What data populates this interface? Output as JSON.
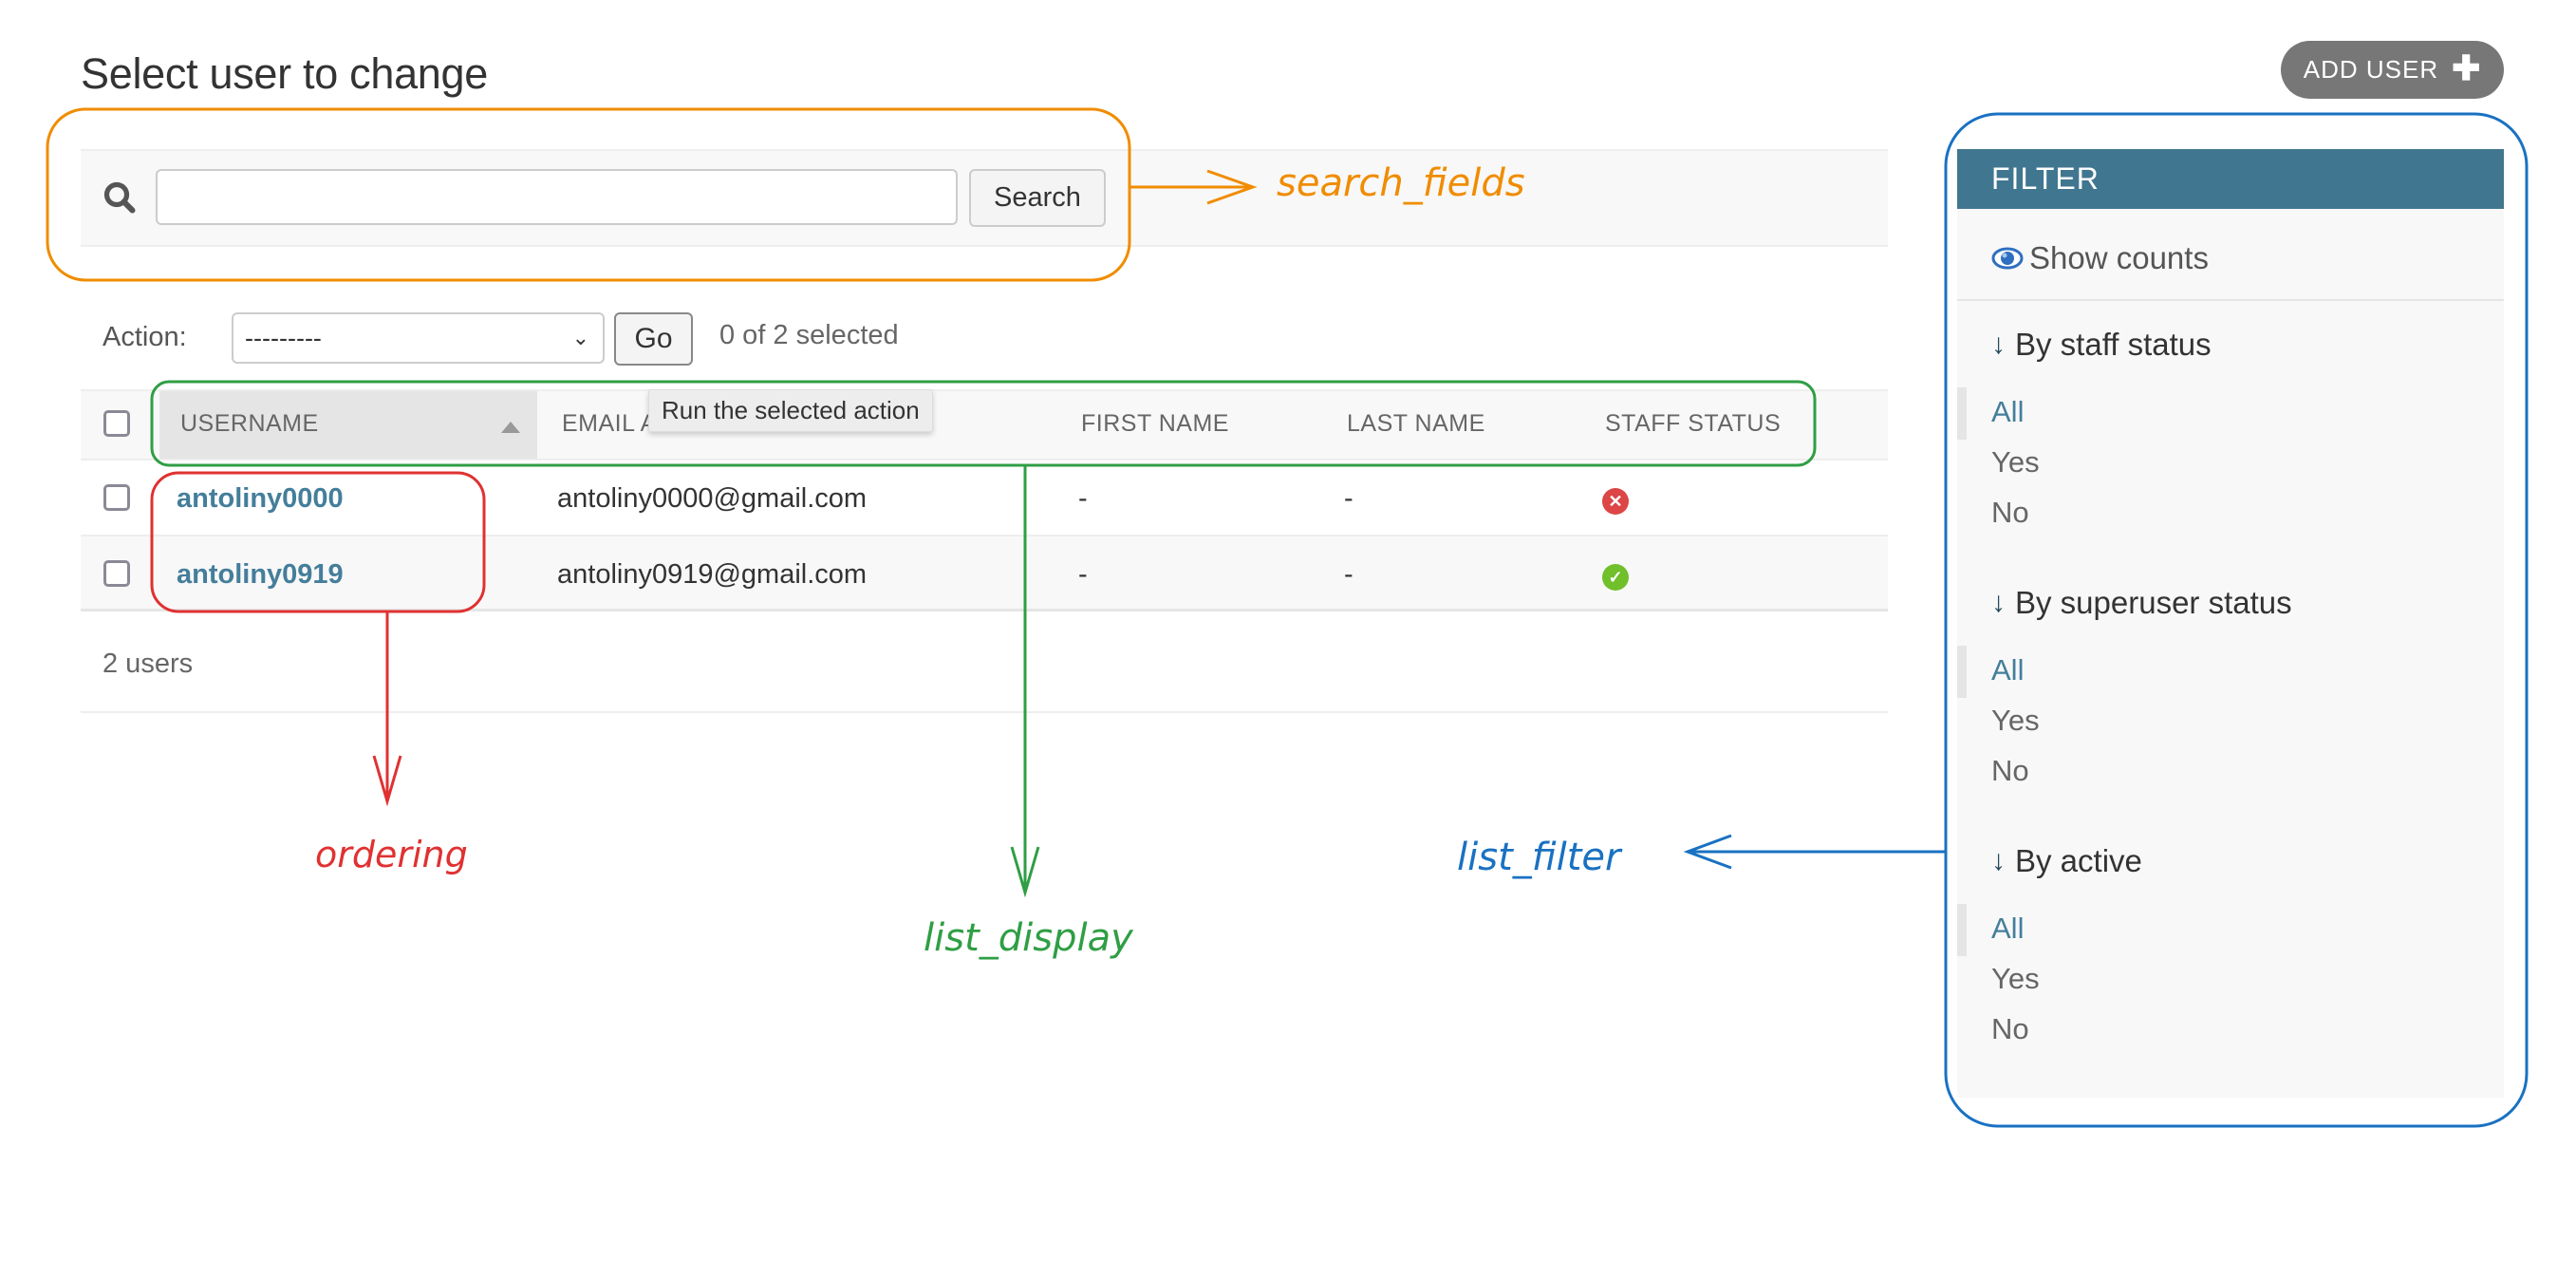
{
  "page": {
    "title": "Select user to change",
    "add_user_label": "ADD USER",
    "add_user_icon": "plus-icon"
  },
  "search": {
    "icon": "search-icon",
    "value": "",
    "placeholder": "",
    "button_label": "Search"
  },
  "actions": {
    "label": "Action:",
    "selected_option": "---------",
    "go_label": "Go",
    "tooltip": "Run the selected action",
    "selected_count": "0 of 2 selected"
  },
  "table": {
    "columns": [
      "USERNAME",
      "EMAIL ADDRESS",
      "FIRST NAME",
      "LAST NAME",
      "STAFF STATUS"
    ],
    "sorted_column": "USERNAME",
    "sort_direction": "ascending",
    "rows": [
      {
        "username": "antoliny0000",
        "email": "antoliny0000@gmail.com",
        "first_name": "-",
        "last_name": "-",
        "staff_status": false,
        "staff_icon": "x-circle-icon",
        "staff_color": "#dd4646"
      },
      {
        "username": "antoliny0919",
        "email": "antoliny0919@gmail.com",
        "first_name": "-",
        "last_name": "-",
        "staff_status": true,
        "staff_icon": "check-circle-icon",
        "staff_color": "#70bf2b"
      }
    ],
    "footer": "2 users"
  },
  "filter": {
    "header": "FILTER",
    "show_counts": "Show counts",
    "show_counts_icon": "eye-icon",
    "groups": [
      {
        "title": "By staff status",
        "options": [
          "All",
          "Yes",
          "No"
        ],
        "selected": "All"
      },
      {
        "title": "By superuser status",
        "options": [
          "All",
          "Yes",
          "No"
        ],
        "selected": "All"
      },
      {
        "title": "By active",
        "options": [
          "All",
          "Yes",
          "No"
        ],
        "selected": "All"
      }
    ]
  },
  "annotations": {
    "search_fields": {
      "text": "search_fields",
      "color": "#f08c00"
    },
    "ordering": {
      "text": "ordering",
      "color": "#e03131"
    },
    "list_display": {
      "text": "list_display",
      "color": "#2f9e44"
    },
    "list_filter": {
      "text": "list_filter",
      "color": "#1971c2"
    }
  },
  "colors": {
    "link": "#447e9b",
    "filter_header": "#417690",
    "add_button": "#777777"
  }
}
